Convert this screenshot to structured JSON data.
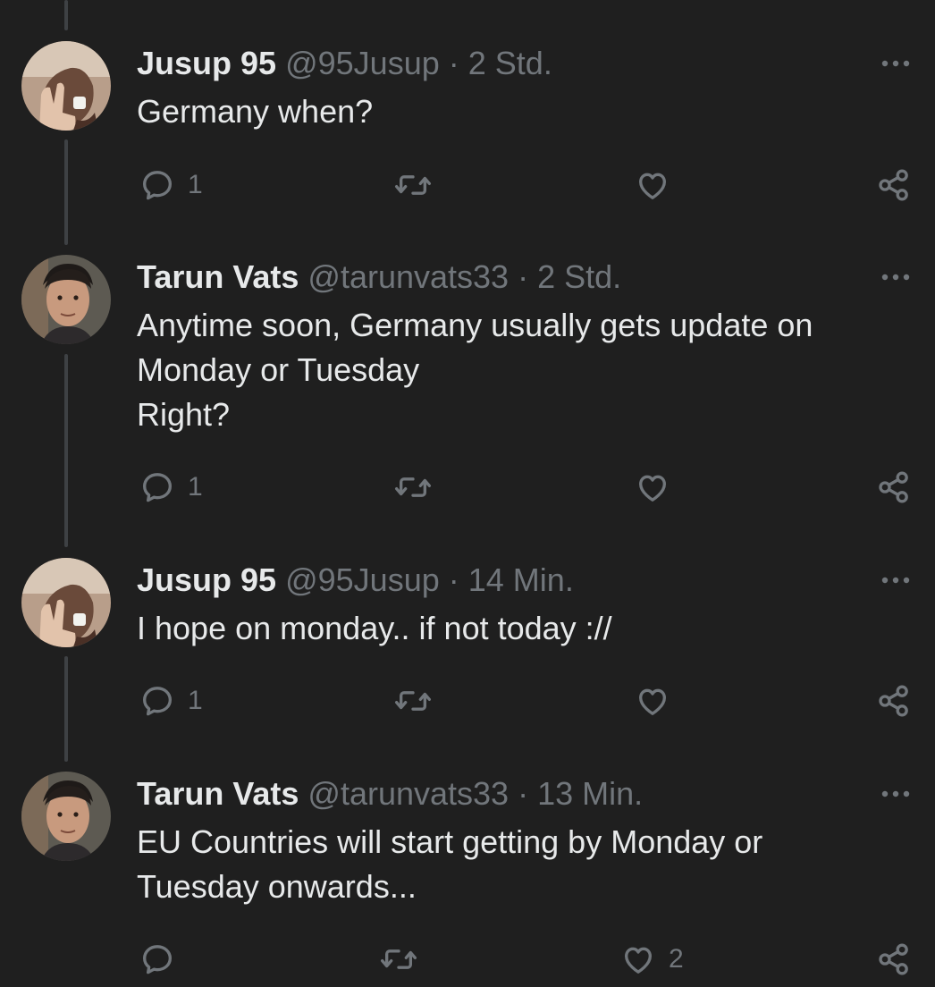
{
  "tweets": [
    {
      "name": "Jusup 95",
      "handle": "@95Jusup",
      "separator": "·",
      "time": "2 Std.",
      "lines": [
        "Germany when?"
      ],
      "reply_count": "1",
      "retweet_count": "",
      "like_count": ""
    },
    {
      "name": "Tarun Vats",
      "handle": "@tarunvats33",
      "separator": "·",
      "time": "2 Std.",
      "lines": [
        "Anytime soon, Germany usually gets update on",
        "Monday or Tuesday",
        "Right?"
      ],
      "reply_count": "1",
      "retweet_count": "",
      "like_count": ""
    },
    {
      "name": "Jusup 95",
      "handle": "@95Jusup",
      "separator": "·",
      "time": "14 Min.",
      "lines": [
        "I hope on monday.. if not today ://"
      ],
      "reply_count": "1",
      "retweet_count": "",
      "like_count": ""
    },
    {
      "name": "Tarun Vats",
      "handle": "@tarunvats33",
      "separator": "·",
      "time": "13 Min.",
      "lines": [
        "EU Countries will start getting by Monday or",
        "Tuesday onwards..."
      ],
      "reply_count": "",
      "retweet_count": "",
      "like_count": "2"
    }
  ],
  "icons": {
    "reply": "reply-icon",
    "retweet": "retweet-icon",
    "like": "heart-icon",
    "share": "share-icon",
    "more": "more-icon"
  },
  "colors": {
    "background": "#1f1f1f",
    "text": "#e7e9ea",
    "muted": "#71767b",
    "thread_line": "#3e4144"
  }
}
